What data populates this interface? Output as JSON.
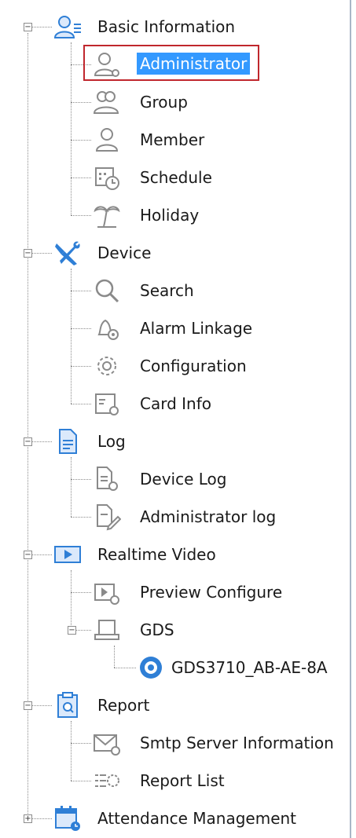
{
  "tree": {
    "basic_information": {
      "label": "Basic Information",
      "toggle": "−",
      "children": {
        "administrator": "Administrator",
        "group": "Group",
        "member": "Member",
        "schedule": "Schedule",
        "holiday": "Holiday"
      }
    },
    "device": {
      "label": "Device",
      "toggle": "−",
      "children": {
        "search": "Search",
        "alarm_linkage": "Alarm Linkage",
        "configuration": "Configuration",
        "card_info": "Card Info"
      }
    },
    "log": {
      "label": "Log",
      "toggle": "−",
      "children": {
        "device_log": "Device Log",
        "administrator_log": "Administrator log"
      }
    },
    "realtime_video": {
      "label": "Realtime Video",
      "toggle": "−",
      "children": {
        "preview_configure": "Preview Configure",
        "gds": {
          "label": "GDS",
          "toggle": "−",
          "children": {
            "device": "GDS3710_AB-AE-8A"
          }
        }
      }
    },
    "report": {
      "label": "Report",
      "toggle": "−",
      "children": {
        "smtp_server_information": "Smtp Server Information",
        "report_list": "Report List"
      }
    },
    "attendance_management": {
      "label": "Attendance Management",
      "toggle": "+"
    }
  },
  "selected_item": "Administrator",
  "colors": {
    "selection_bg": "#3399ff",
    "selection_outline": "#c0272d",
    "icon_blue": "#2f7fd6",
    "icon_gray": "#8a8a8a"
  }
}
